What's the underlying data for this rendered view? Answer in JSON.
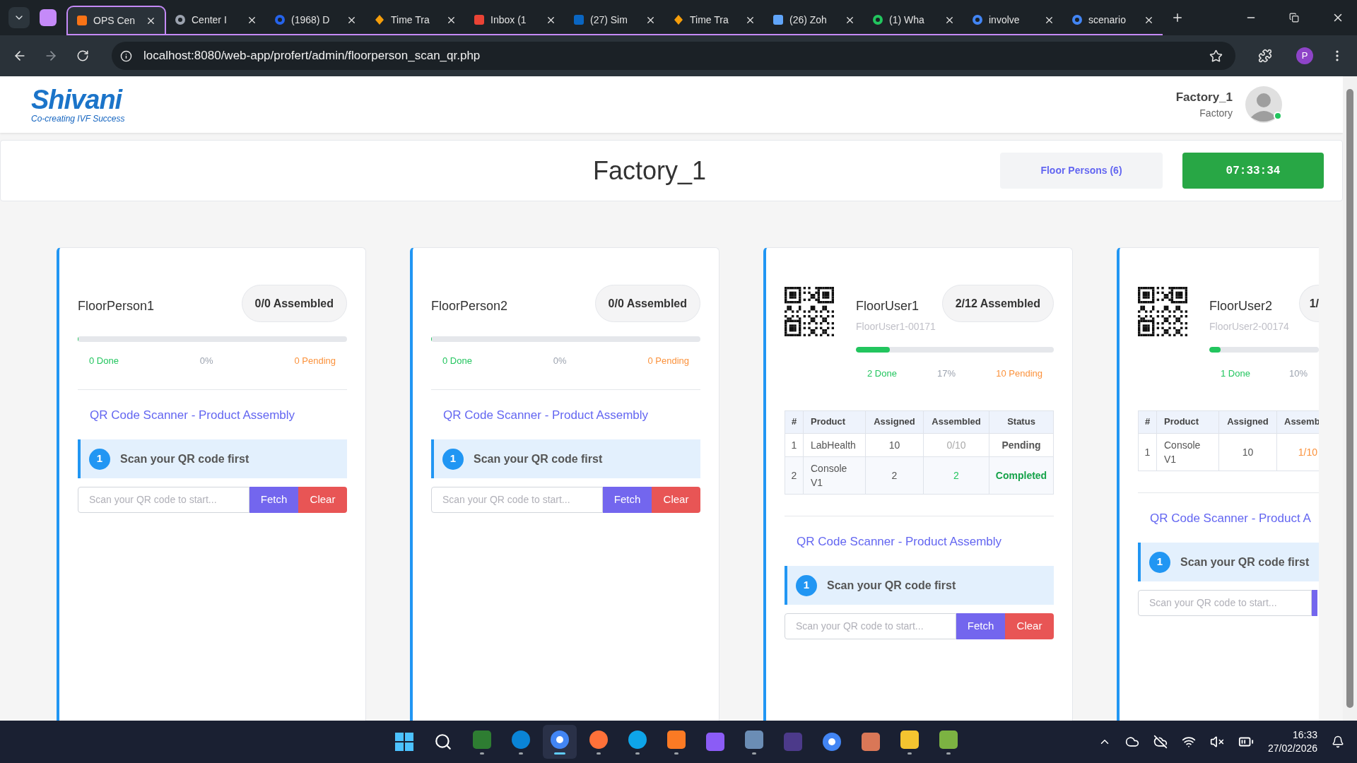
{
  "browser": {
    "tabs": [
      {
        "title": "OPS Cen",
        "selected": true
      },
      {
        "title": "Center I",
        "selected": false
      },
      {
        "title": "(1968) D",
        "selected": false
      },
      {
        "title": "Time Tra",
        "selected": false
      },
      {
        "title": "Inbox (1",
        "selected": false
      },
      {
        "title": "(27) Sim",
        "selected": false
      },
      {
        "title": "Time Tra",
        "selected": false
      },
      {
        "title": "(26) Zoh",
        "selected": false
      },
      {
        "title": "(1) Wha",
        "selected": false
      },
      {
        "title": "involve",
        "selected": false
      },
      {
        "title": "scenario",
        "selected": false
      }
    ],
    "url": "localhost:8080/web-app/profert/admin/floorperson_scan_qr.php",
    "profile_initial": "P"
  },
  "header": {
    "logo": "Shivani",
    "tagline": "Co-creating IVF Success",
    "user_name": "Factory_1",
    "user_role": "Factory",
    "online": true
  },
  "toolbar": {
    "title": "Factory_1",
    "floor_persons_button": "Floor Persons (6)",
    "timer": "07:33:34"
  },
  "cards": [
    {
      "kind": "plain",
      "cut": false,
      "name": "FloorPerson1",
      "badge": "0/0 Assembled",
      "level": 0,
      "done": "0 Done",
      "percent": "0%",
      "pending": "0 Pending",
      "scanner_title": "QR Code Scanner - Product Assembly",
      "step_number": "1",
      "step_text": "Scan your QR code first",
      "placeholder": "Scan your QR code to start...",
      "buttons": [
        {
          "kind": "fetch",
          "label": "Fetch"
        },
        {
          "kind": "clear",
          "label": "Clear"
        }
      ]
    },
    {
      "kind": "plain",
      "cut": false,
      "name": "FloorPerson2",
      "badge": "0/0 Assembled",
      "level": 0,
      "done": "0 Done",
      "percent": "0%",
      "pending": "0 Pending",
      "scanner_title": "QR Code Scanner - Product Assembly",
      "step_number": "1",
      "step_text": "Scan your QR code first",
      "placeholder": "Scan your QR code to start...",
      "buttons": [
        {
          "kind": "fetch",
          "label": "Fetch"
        },
        {
          "kind": "clear",
          "label": "Clear"
        }
      ]
    },
    {
      "kind": "qr",
      "cut": false,
      "name": "FloorUser1",
      "code": "FloorUser1-00171",
      "badge": "2/12 Assembled",
      "level": 0.17,
      "done": "2 Done",
      "percent": "17%",
      "pending": "10 Pending",
      "table": {
        "columns": [
          "#",
          "Product",
          "Assigned",
          "Assembled",
          "Status"
        ],
        "rows": [
          {
            "cells": [
              {
                "text": "1"
              },
              {
                "text": "LabHealth"
              },
              {
                "text": "10"
              },
              {
                "text": "0/10",
                "color": "#aaaaaa"
              },
              {
                "text": "Pending",
                "color": "#555555"
              }
            ]
          },
          {
            "cells": [
              {
                "text": "2"
              },
              {
                "text": "Console V1"
              },
              {
                "text": "2"
              },
              {
                "text": "2",
                "color": "#22c55e"
              },
              {
                "text": "Completed",
                "color": "#16a34a"
              }
            ]
          }
        ]
      },
      "scanner_title": "QR Code Scanner - Product Assembly",
      "step_number": "1",
      "step_text": "Scan your QR code first",
      "placeholder": "Scan your QR code to start...",
      "buttons": [
        {
          "kind": "fetch",
          "label": "Fetch"
        },
        {
          "kind": "clear",
          "label": "Clear"
        }
      ]
    },
    {
      "kind": "qr",
      "cut": true,
      "name": "FloorUser2",
      "code": "FloorUser2-00174",
      "badge": "1/",
      "level": 0.1,
      "done": "1 Done",
      "percent": "10%",
      "table": {
        "columns": [
          "#",
          "Product",
          "Assigned",
          "Assemb"
        ],
        "rows": [
          {
            "cells": [
              {
                "text": "1"
              },
              {
                "text": "Console V1"
              },
              {
                "text": "10"
              },
              {
                "text": "1/10",
                "color": "#fb923c"
              }
            ]
          }
        ]
      },
      "scanner_title": "QR Code Scanner - Product A",
      "step_number": "1",
      "step_text": "Scan your QR code first",
      "placeholder": "Scan your QR code to start...",
      "buttons": [
        {
          "kind": "fetch"
        }
      ]
    }
  ],
  "taskbar": {
    "time": "16:33",
    "date": "27/02/2026"
  }
}
